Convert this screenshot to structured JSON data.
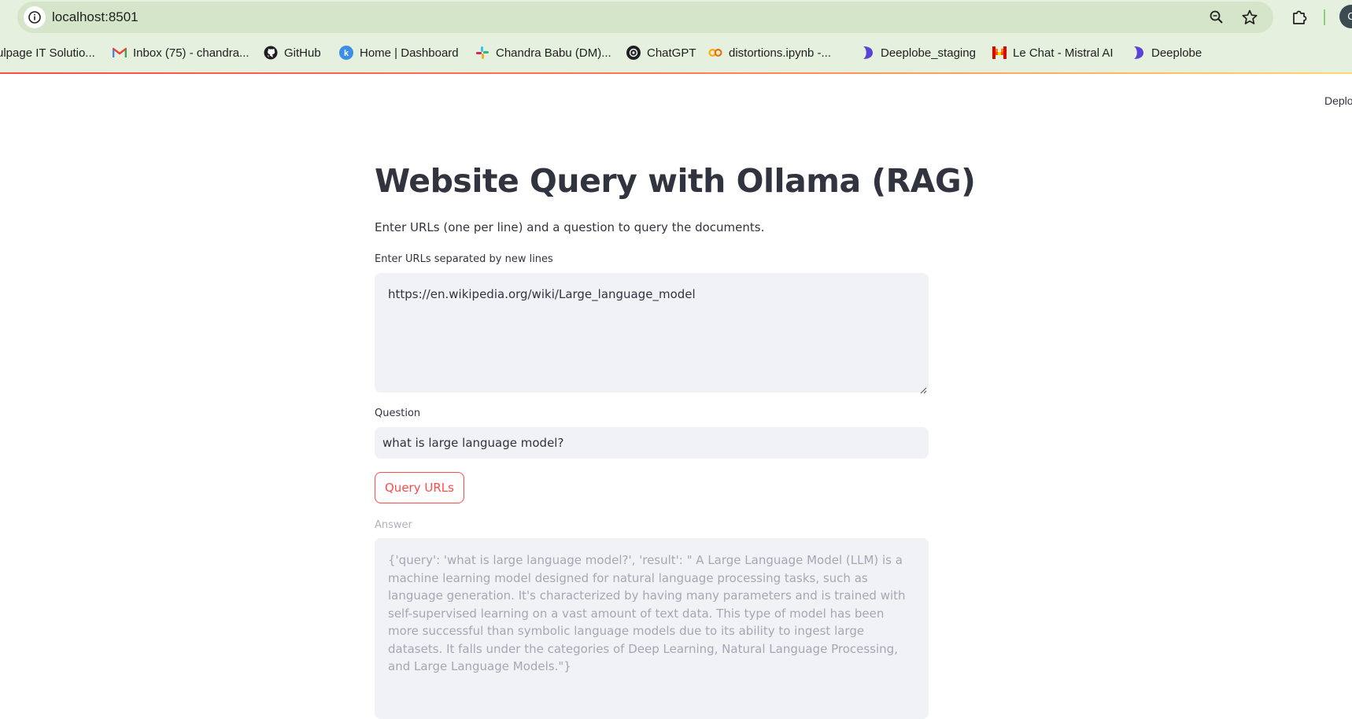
{
  "browser": {
    "url": "localhost:8501",
    "profile_initial": "C",
    "bookmarks": [
      {
        "label": "ulpage IT Solutio...",
        "icon": "ulpage-icon"
      },
      {
        "label": "Inbox (75) - chandra...",
        "icon": "gmail-icon"
      },
      {
        "label": "GitHub",
        "icon": "github-icon"
      },
      {
        "label": "Home | Dashboard",
        "icon": "k-dashboard-icon"
      },
      {
        "label": "Chandra Babu (DM)...",
        "icon": "slack-icon"
      },
      {
        "label": "ChatGPT",
        "icon": "chatgpt-icon"
      },
      {
        "label": "distortions.ipynb -...",
        "icon": "colab-icon"
      },
      {
        "label": "Deeplobe_staging",
        "icon": "deeplobe-icon"
      },
      {
        "label": "Le Chat - Mistral AI",
        "icon": "mistral-icon"
      },
      {
        "label": "Deeplobe",
        "icon": "deeplobe-icon"
      }
    ]
  },
  "app": {
    "deploy_label": "Deplo",
    "title": "Website Query with Ollama (RAG)",
    "subtitle": "Enter URLs (one per line) and a question to query the documents.",
    "urls_label": "Enter URLs separated by new lines",
    "urls_value": "https://en.wikipedia.org/wiki/Large_language_model",
    "question_label": "Question",
    "question_value": "what is large language model?",
    "query_button_label": "Query URLs",
    "answer_label": "Answer",
    "answer_value": "{'query': 'what is large language model?', 'result': \" A Large Language Model (LLM) is a machine learning model designed for natural language processing tasks, such as language generation. It's characterized by having many parameters and is trained with self-supervised learning on a vast amount of text data. This type of model has been more successful than symbolic language models due to its ability to ingest large datasets. It falls under the categories of Deep Learning, Natural Language Processing, and Large Language Models.\"}"
  },
  "colors": {
    "accent": "#ff4b4b",
    "text": "#31333f",
    "input_bg": "#f0f2f6",
    "chrome_bg": "#e6f0de"
  }
}
